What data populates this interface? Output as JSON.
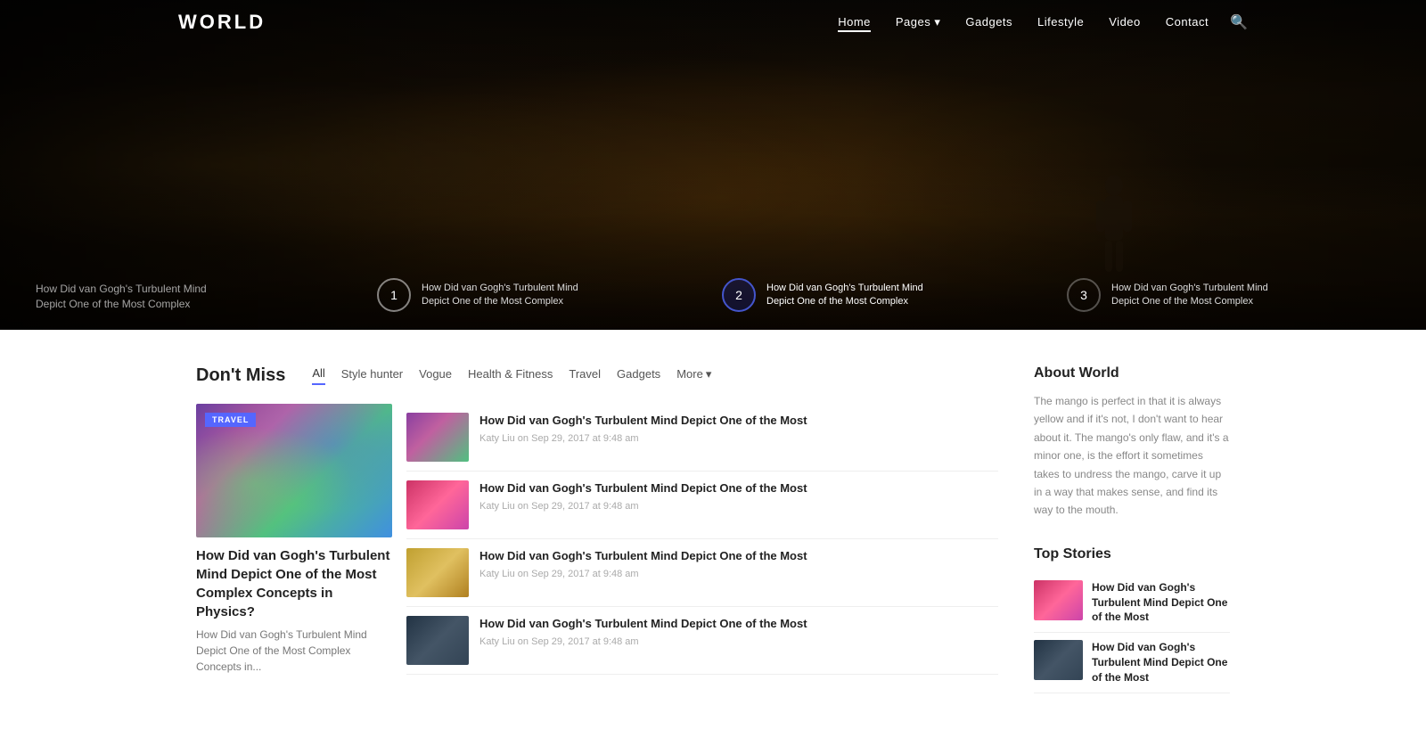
{
  "site": {
    "logo": "WORLD",
    "nav": [
      {
        "label": "Home",
        "active": true
      },
      {
        "label": "Pages",
        "has_dropdown": true
      },
      {
        "label": "Gadgets"
      },
      {
        "label": "Lifestyle"
      },
      {
        "label": "Video"
      },
      {
        "label": "Contact"
      }
    ]
  },
  "hero": {
    "slides": [
      {
        "id": 1,
        "title_line1": "How Did van Gogh's Turbulent Mind",
        "title_line2": "Depict One of the Most Complex",
        "active": false,
        "partial": false
      },
      {
        "id": 2,
        "title_line1": "How Did van Gogh's Turbulent Mind",
        "title_line2": "Depict One of the Most Complex",
        "active": true,
        "partial": false
      },
      {
        "id": 3,
        "title_line1": "How Did van Gogh's Turbulent Mind",
        "title_line2": "Depict One of the Most Complex",
        "active": false,
        "partial": true
      }
    ],
    "left_caption_line1": "How Did van Gogh's Turbulent Mind",
    "left_caption_line2": "Depict One of the Most Complex"
  },
  "dont_miss": {
    "section_title": "Don't Miss",
    "tabs": [
      {
        "label": "All",
        "active": true
      },
      {
        "label": "Style hunter"
      },
      {
        "label": "Vogue"
      },
      {
        "label": "Health & Fitness"
      },
      {
        "label": "Travel"
      },
      {
        "label": "Gadgets"
      },
      {
        "label": "More"
      }
    ],
    "featured_article": {
      "badge": "TRAVEL",
      "title": "How Did van Gogh's Turbulent Mind Depict One of the Most Complex Concepts in Physics?",
      "excerpt": "How Did van Gogh's Turbulent Mind Depict One of the Most Complex Concepts in..."
    },
    "articles": [
      {
        "img_type": "aurora",
        "title": "How Did van Gogh's Turbulent Mind Depict One of the Most",
        "author": "Katy Liu",
        "date": "Sep 29, 2017 at 9:48 am"
      },
      {
        "img_type": "pink",
        "title": "How Did van Gogh's Turbulent Mind Depict One of the Most",
        "author": "Katy Liu",
        "date": "Sep 29, 2017 at 9:48 am"
      },
      {
        "img_type": "drinks",
        "title": "How Did van Gogh's Turbulent Mind Depict One of the Most",
        "author": "Katy Liu",
        "date": "Sep 29, 2017 at 9:48 am"
      },
      {
        "img_type": "dark",
        "title": "How Did van Gogh's Turbulent Mind Depict One of the Most",
        "author": "Katy Liu",
        "date": "Sep 29, 2017 at 9:48 am"
      }
    ]
  },
  "sidebar": {
    "about_title": "About World",
    "about_text": "The mango is perfect in that it is always yellow and if it's not, I don't want to hear about it. The mango's only flaw, and it's a minor one, is the effort it sometimes takes to undress the mango, carve it up in a way that makes sense, and find its way to the mouth.",
    "top_stories_title": "Top Stories",
    "top_stories": [
      {
        "img_type": "pink",
        "title": "How Did van Gogh's Turbulent Mind Depict One of the Most"
      },
      {
        "img_type": "dark2",
        "title": "How Did van Gogh's Turbulent Mind Depict One of the Most"
      }
    ]
  },
  "colors": {
    "accent": "#5566ff",
    "text_dark": "#222222",
    "text_light": "#777777",
    "border": "#eeeeee"
  }
}
